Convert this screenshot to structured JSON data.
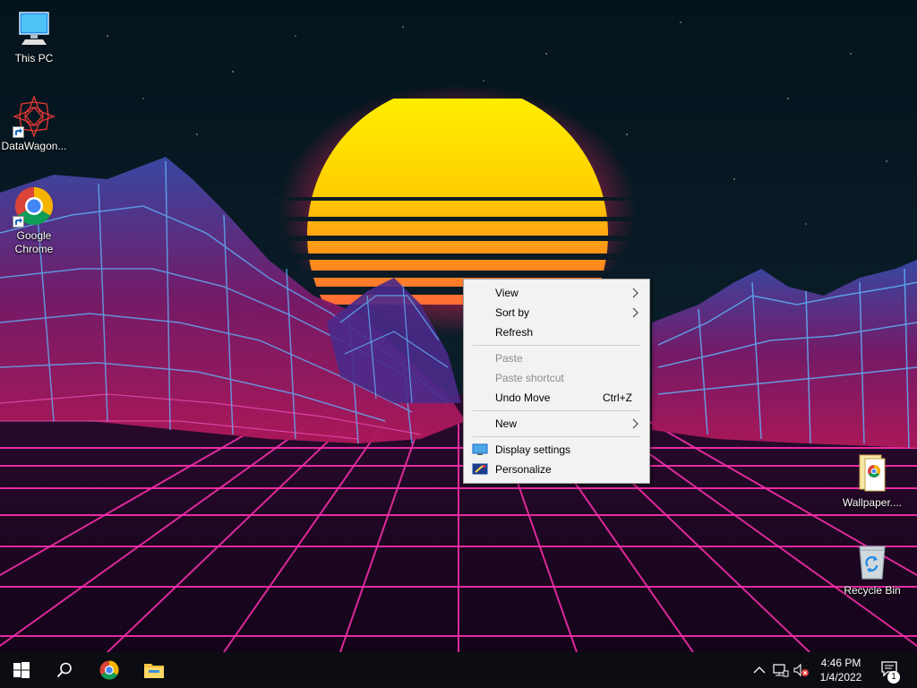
{
  "desktop": {
    "icons": [
      {
        "label": "This PC",
        "icon": "computer-icon"
      },
      {
        "label": "DataWagon...",
        "icon": "datawagon-icon"
      },
      {
        "label": "Google Chrome",
        "icon": "chrome-icon"
      },
      {
        "label": "Wallpaper....",
        "icon": "wallpaper-folder-icon"
      },
      {
        "label": "Recycle Bin",
        "icon": "recycle-bin-icon"
      }
    ]
  },
  "context_menu": {
    "items": [
      {
        "label": "View",
        "submenu": true,
        "enabled": true
      },
      {
        "label": "Sort by",
        "submenu": true,
        "enabled": true
      },
      {
        "label": "Refresh",
        "enabled": true
      },
      {
        "label": "Paste",
        "enabled": false
      },
      {
        "label": "Paste shortcut",
        "enabled": false
      },
      {
        "label": "Undo Move",
        "shortcut": "Ctrl+Z",
        "enabled": true
      },
      {
        "label": "New",
        "submenu": true,
        "enabled": true
      },
      {
        "label": "Display settings",
        "icon": "display-settings-icon",
        "enabled": true
      },
      {
        "label": "Personalize",
        "icon": "personalize-icon",
        "enabled": true
      }
    ]
  },
  "taskbar": {
    "buttons": [
      "start-icon",
      "search-icon",
      "chrome-icon",
      "file-explorer-icon"
    ],
    "tray": [
      "chevron-up-icon",
      "network-icon",
      "volume-muted-icon"
    ],
    "clock": {
      "time": "4:46 PM",
      "date": "1/4/2022"
    },
    "notifications": {
      "count": "1"
    }
  },
  "colors": {
    "sun_top": "#ffe600",
    "sun_bottom": "#ff3a6e",
    "grid": "#ff2fae",
    "mountain": "#3aa0ff",
    "taskbar": "#0b0d12",
    "menu_bg": "#f2f2f2"
  }
}
